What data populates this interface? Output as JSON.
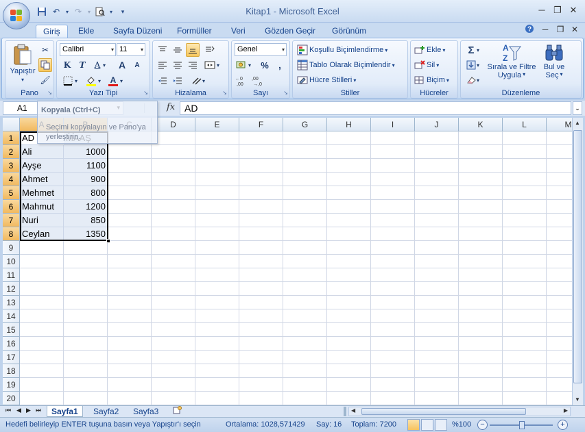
{
  "window": {
    "title": "Kitap1 - Microsoft Excel",
    "minimize": "─",
    "restore": "❐",
    "close": "✕"
  },
  "qat": {
    "save_icon": "save-icon",
    "undo_icon": "undo-icon",
    "redo_icon": "redo-icon",
    "preview_icon": "print-preview-icon",
    "customize": "▾"
  },
  "tabs": [
    {
      "label": "Giriş",
      "active": true
    },
    {
      "label": "Ekle"
    },
    {
      "label": "Sayfa Düzeni"
    },
    {
      "label": "Formüller"
    },
    {
      "label": "Veri"
    },
    {
      "label": "Gözden Geçir"
    },
    {
      "label": "Görünüm"
    }
  ],
  "ribbon": {
    "pano": {
      "label": "Pano",
      "paste": "Yapıştır"
    },
    "font": {
      "label": "Yazı Tipi",
      "font_name": "Calibri",
      "font_size": "11",
      "bold": "K",
      "italic": "T",
      "underline": "A",
      "grow": "A",
      "shrink": "A"
    },
    "align": {
      "label": "Hizalama"
    },
    "number": {
      "label": "Sayı",
      "format": "Genel",
      "percent": "%",
      "comma": ","
    },
    "styles": {
      "label": "Stiller",
      "conditional": "Koşullu Biçimlendirme",
      "table": "Tablo Olarak Biçimlendir",
      "cell": "Hücre Stilleri"
    },
    "cells": {
      "label": "Hücreler",
      "insert": "Ekle",
      "delete": "Sil",
      "format": "Biçim"
    },
    "edit": {
      "label": "Düzenleme",
      "sort_line1": "Sırala ve Filtre",
      "sort_line2": "Uygula",
      "find_line1": "Bul ve",
      "find_line2": "Seç"
    }
  },
  "formula": {
    "name_box": "A1",
    "fx": "fx",
    "value": "AD"
  },
  "tooltip": {
    "title": "Kopyala (Ctrl+C)",
    "body": "Seçimi kopyalayın ve Pano'ya yerleştirin."
  },
  "columns": [
    "A",
    "B",
    "C",
    "D",
    "E",
    "F",
    "G",
    "H",
    "I",
    "J",
    "K",
    "L",
    "M"
  ],
  "rows": [
    "1",
    "2",
    "3",
    "4",
    "5",
    "6",
    "7",
    "8",
    "9",
    "10",
    "11",
    "12",
    "13",
    "14",
    "15",
    "16",
    "17",
    "18",
    "19",
    "20"
  ],
  "table": {
    "header": [
      "AD",
      "MAAŞ"
    ],
    "rows": [
      [
        "Ali",
        "1000"
      ],
      [
        "Ayşe",
        "1100"
      ],
      [
        "Ahmet",
        "900"
      ],
      [
        "Mehmet",
        "800"
      ],
      [
        "Mahmut",
        "1200"
      ],
      [
        "Nuri",
        "850"
      ],
      [
        "Ceylan",
        "1350"
      ]
    ]
  },
  "sheets": [
    {
      "label": "Sayfa1",
      "active": true
    },
    {
      "label": "Sayfa2"
    },
    {
      "label": "Sayfa3"
    }
  ],
  "status": {
    "message": "Hedefi belirleyip ENTER tuşuna basın veya Yapıştır'ı seçin",
    "average": "Ortalama: 1028,571429",
    "count": "Say: 16",
    "sum": "Toplam: 7200",
    "zoom": "%100"
  },
  "colors": {
    "accent": "#15428b",
    "selection_header": "#f1b95f"
  }
}
